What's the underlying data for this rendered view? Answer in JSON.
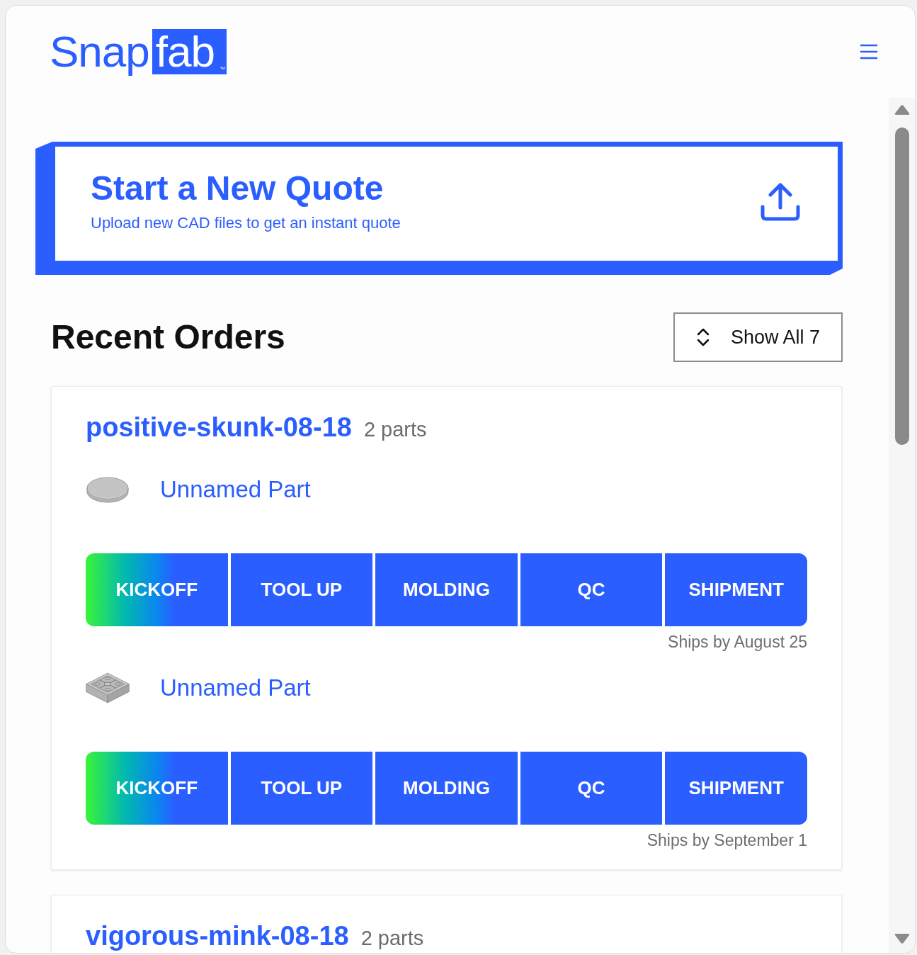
{
  "header": {
    "logo": {
      "text": "Snap",
      "badge": "fab",
      "mark": "™"
    }
  },
  "new_quote": {
    "title": "Start a New Quote",
    "subtitle": "Upload new CAD files to get an instant quote"
  },
  "recent_orders": {
    "title": "Recent Orders",
    "show_all": "Show All 7"
  },
  "orders": [
    {
      "name": "positive-skunk-08-18",
      "count": "2 parts",
      "parts": [
        {
          "kind": "disc",
          "name": "Unnamed Part",
          "stages": [
            {
              "label": "KICKOFF",
              "current": true
            },
            {
              "label": "TOOL UP",
              "current": false
            },
            {
              "label": "MOLDING",
              "current": false
            },
            {
              "label": "QC",
              "current": false
            },
            {
              "label": "SHIPMENT",
              "current": false
            }
          ],
          "ships": "Ships by August 25"
        },
        {
          "kind": "tray",
          "name": "Unnamed Part",
          "stages": [
            {
              "label": "KICKOFF",
              "current": true
            },
            {
              "label": "TOOL UP",
              "current": false
            },
            {
              "label": "MOLDING",
              "current": false
            },
            {
              "label": "QC",
              "current": false
            },
            {
              "label": "SHIPMENT",
              "current": false
            }
          ],
          "ships": "Ships by September 1"
        }
      ]
    },
    {
      "name": "vigorous-mink-08-18",
      "count": "2 parts"
    }
  ]
}
